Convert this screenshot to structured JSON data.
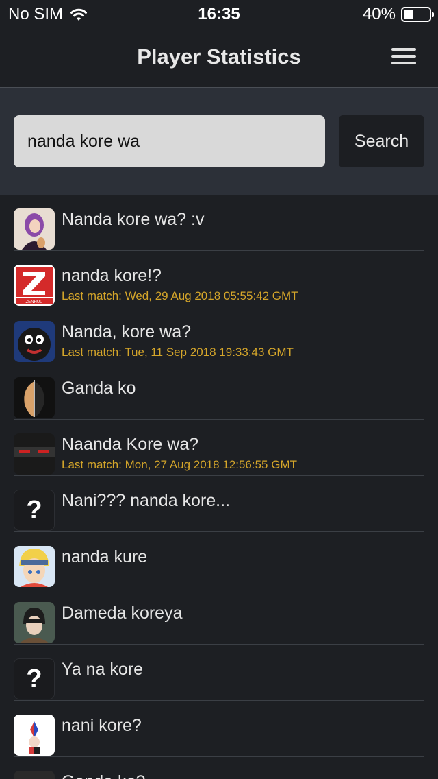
{
  "status_bar": {
    "carrier": "No SIM",
    "time": "16:35",
    "battery": "40%",
    "battery_level": 0.4
  },
  "nav": {
    "title": "Player Statistics",
    "menu_icon": "hamburger-icon"
  },
  "search": {
    "value": "nanda kore wa",
    "button_label": "Search"
  },
  "results": [
    {
      "name": "Nanda kore wa? :v",
      "last_match": "",
      "avatar": "anime-girl-purple"
    },
    {
      "name": "nanda kore!?",
      "last_match": "Last match: Wed, 29 Aug 2018 05:55:42 GMT",
      "avatar": "zenhuu-logo"
    },
    {
      "name": "Nanda, kore wa?",
      "last_match": "Last match: Tue, 11 Sep 2018 19:33:43 GMT",
      "avatar": "blue-monster"
    },
    {
      "name": "Ganda ko",
      "last_match": "",
      "avatar": "half-face-warrior"
    },
    {
      "name": "Naanda Kore wa?",
      "last_match": "Last match: Mon, 27 Aug 2018 12:56:55 GMT",
      "avatar": "dark-eyes"
    },
    {
      "name": "Nani??? nanda kore...",
      "last_match": "",
      "avatar": "unknown-question"
    },
    {
      "name": "nanda kure",
      "last_match": "",
      "avatar": "blonde-ninja"
    },
    {
      "name": "Dameda koreya",
      "last_match": "",
      "avatar": "soldier-anime"
    },
    {
      "name": "Ya na kore",
      "last_match": "",
      "avatar": "unknown-question"
    },
    {
      "name": "nani kore?",
      "last_match": "",
      "avatar": "harley-clown"
    },
    {
      "name": "Ganda ko?",
      "last_match": "",
      "avatar": "dark-partial"
    }
  ]
}
